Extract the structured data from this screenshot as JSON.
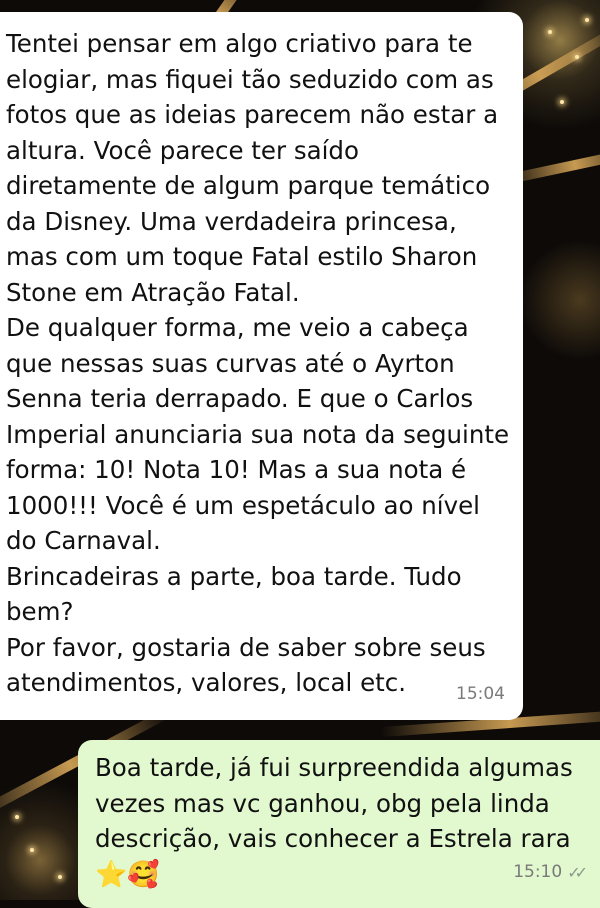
{
  "incoming": {
    "paragraphs": [
      "Tentei pensar em algo criativo para te\nelogiar, mas fiquei tão seduzido com as\nfotos que as ideias parecem não estar a\naltura. Você parece ter saído\ndiretamente de algum parque temático\nda Disney. Uma verdadeira princesa,\nmas com um toque Fatal estilo Sharon\nStone em Atração Fatal.",
      "De qualquer forma, me veio a cabeça\nque nessas suas curvas até o Ayrton\nSenna teria derrapado. E que o Carlos\nImperial anunciaria sua nota da seguinte\nforma: 10! Nota 10! Mas a sua nota é\n1000!!! Você é um espetáculo ao nível\ndo Carnaval.",
      "Brincadeiras a parte, boa tarde. Tudo\nbem?",
      "Por favor, gostaria de saber sobre seus\natendimentos, valores, local etc."
    ],
    "time": "15:04"
  },
  "outgoing": {
    "text": "Boa tarde, já fui surpreendida algumas\nvezes mas vc ganhou, obg pela linda\ndescrição, vais conhecer a Estrela rara",
    "emojis": "⭐🥰",
    "time": "15:10",
    "status_icon": "double-check-icon",
    "status_glyph": "✓✓"
  },
  "colors": {
    "incoming_bubble": "#ffffff",
    "outgoing_bubble": "#e2f8cf",
    "background": "#0d0a08"
  }
}
